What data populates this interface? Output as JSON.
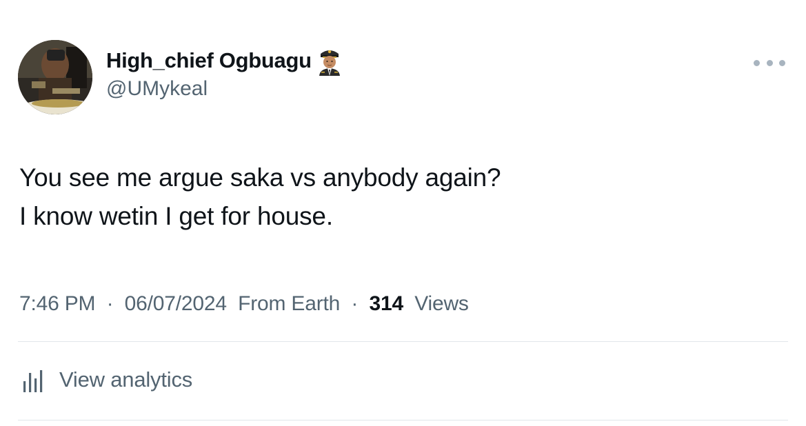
{
  "author": {
    "display_name": "High_chief Ogbuagu",
    "handle": "@UMykeal",
    "badge_icon": "pilot-emoji-icon"
  },
  "tweet": {
    "lines": [
      "You see me argue saka vs anybody again?",
      "I know wetin I get for house."
    ]
  },
  "meta": {
    "time": "7:46 PM",
    "separator": "·",
    "date": "06/07/2024",
    "source": "From Earth",
    "views_count": "314",
    "views_label": "Views"
  },
  "actions": {
    "more_icon": "more-horizontal-icon",
    "analytics_icon": "bar-chart-icon",
    "analytics_label": "View analytics"
  },
  "colors": {
    "text_primary": "#0f1419",
    "text_secondary": "#536471",
    "divider": "#e1e6ea"
  }
}
